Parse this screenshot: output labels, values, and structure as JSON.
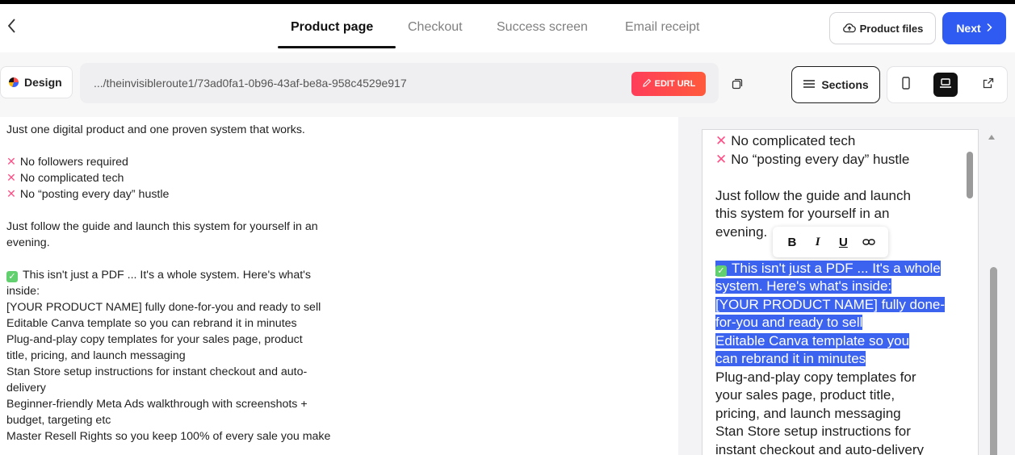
{
  "nav": {
    "tabs": [
      {
        "label": "Product page",
        "active": true
      },
      {
        "label": "Checkout",
        "active": false
      },
      {
        "label": "Success screen",
        "active": false
      },
      {
        "label": "Email receipt",
        "active": false
      }
    ],
    "product_files_label": "Product files",
    "next_label": "Next"
  },
  "toolbar": {
    "design_label": "Design",
    "url": ".../theinvisibleroute1/73ad0fa1-0b96-43af-be8a-958c4529e917",
    "edit_url_label": "EDIT URL",
    "sections_label": "Sections"
  },
  "editor": {
    "lines": [
      "Just one digital product and one proven system that works.",
      "No followers required",
      "No complicated tech",
      "No “posting every day” hustle",
      "Just follow the guide and launch this system for yourself in an",
      "evening.",
      "This isn't just a PDF ... It's a whole system. Here's what's",
      "inside:",
      "[YOUR PRODUCT NAME] fully done-for-you and ready to sell",
      "Editable Canva template so you can rebrand it in minutes",
      "Plug-and-play copy templates for your sales page, product",
      "title, pricing, and launch messaging",
      "Stan Store setup instructions for instant checkout and auto-",
      "delivery",
      "Beginner-friendly Meta Ads walkthrough with screenshots +",
      "budget, targeting etc",
      "Master Resell Rights so you keep 100% of every sale you make"
    ]
  },
  "preview": {
    "lines": [
      "No complicated tech",
      "No “posting every day” hustle",
      "Just follow the guide and launch",
      "this system for yourself in an",
      "evening.",
      "This isn't just a PDF ... It's a whole",
      "system. Here's what's inside:",
      "[YOUR PRODUCT NAME] fully done-",
      "for-you and ready to sell",
      "Editable Canva template so you",
      "can rebrand it in minutes",
      "Plug-and-play copy templates for",
      "your sales page, product title,",
      "pricing, and launch messaging",
      "Stan Store setup instructions for",
      "instant checkout and auto-delivery"
    ],
    "format_buttons": [
      "B",
      "I",
      "U"
    ]
  },
  "colors": {
    "accent": "#2f5bf3",
    "selection": "#3c62f0",
    "edit_url": "#ff4a4a",
    "x_mark": "#ff4f86",
    "check": "#62d06e"
  },
  "icons": [
    "back-icon",
    "upload-cloud-icon",
    "chevron-right-icon",
    "color-palette-icon",
    "pencil-icon",
    "copy-icon",
    "menu-lines-icon",
    "mobile-icon",
    "laptop-icon",
    "external-link-icon",
    "link-icon",
    "x-mark-icon",
    "checkbox-icon"
  ]
}
